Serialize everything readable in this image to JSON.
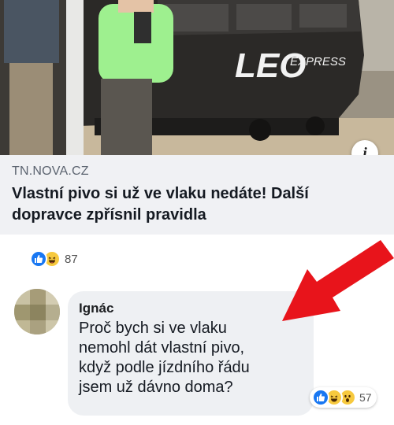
{
  "link_preview": {
    "source": "TN.NOVA.CZ",
    "title": "Vlastní pivo si už ve vlaku nedáte! Další dopravce zpřísnil pravidla",
    "photo_brand": "LEO",
    "photo_brand_sub": "EXPRESS",
    "info_icon": "i"
  },
  "post_reactions": {
    "icons": [
      "like-icon",
      "haha-icon"
    ],
    "count": "87"
  },
  "comment": {
    "author": "Ignác",
    "lines": [
      "Proč bych si ve vlaku",
      "nemohl dát vlastní pivo,",
      "když podle jízdního řádu",
      "jsem už dávno doma?"
    ],
    "reactions": {
      "icons": [
        "like-icon",
        "haha-icon",
        "wow-icon"
      ],
      "count": "57"
    }
  },
  "colors": {
    "link_card_bg": "#f0f1f4",
    "bubble_bg": "#eef0f3",
    "like_blue": "#1877f2",
    "arrow_red": "#e8141b"
  }
}
